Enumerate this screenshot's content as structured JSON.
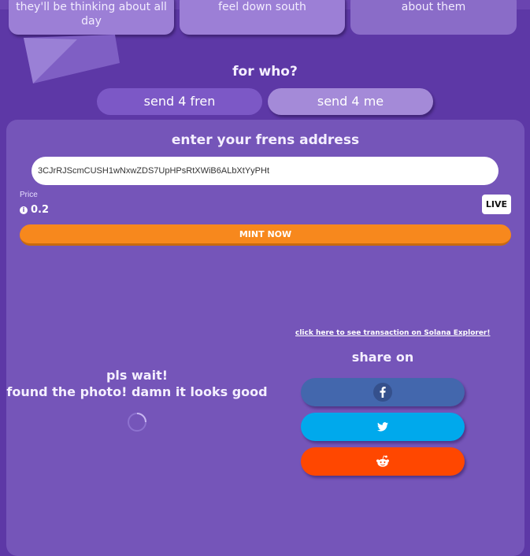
{
  "top_cards": [
    {
      "text": "they'll be thinking about all day"
    },
    {
      "text": "feel down south"
    },
    {
      "text": "about them"
    }
  ],
  "recipient": {
    "heading": "for who?",
    "options": [
      "send 4 fren",
      "send 4 me"
    ],
    "selected": "send 4 me"
  },
  "form": {
    "title": "enter your frens address",
    "address_value": "3CJrRJScmCUSH1wNxwZDS7UpHPsRtXWiB6ALbXtYyPHt"
  },
  "price": {
    "label": "Price",
    "value": "0.2",
    "currency_icon": "info-icon"
  },
  "live_badge": "LIVE",
  "mint_button": "MINT NOW",
  "explorer_link": "click here to see transaction on Solana Explorer!",
  "share": {
    "label": "share on",
    "buttons": [
      {
        "network": "facebook",
        "icon": "facebook-icon",
        "color": "#4367ad"
      },
      {
        "network": "twitter",
        "icon": "twitter-icon",
        "color": "#00a9ec"
      },
      {
        "network": "reddit",
        "icon": "reddit-icon",
        "color": "#ff4700"
      }
    ]
  },
  "status": {
    "line1": "pls wait!",
    "line2": "found the photo! damn it looks good"
  },
  "colors": {
    "background": "#5d38a6",
    "panel": "#7555b9",
    "accent_orange": "#f7881d",
    "card": "#9c7fd6"
  }
}
